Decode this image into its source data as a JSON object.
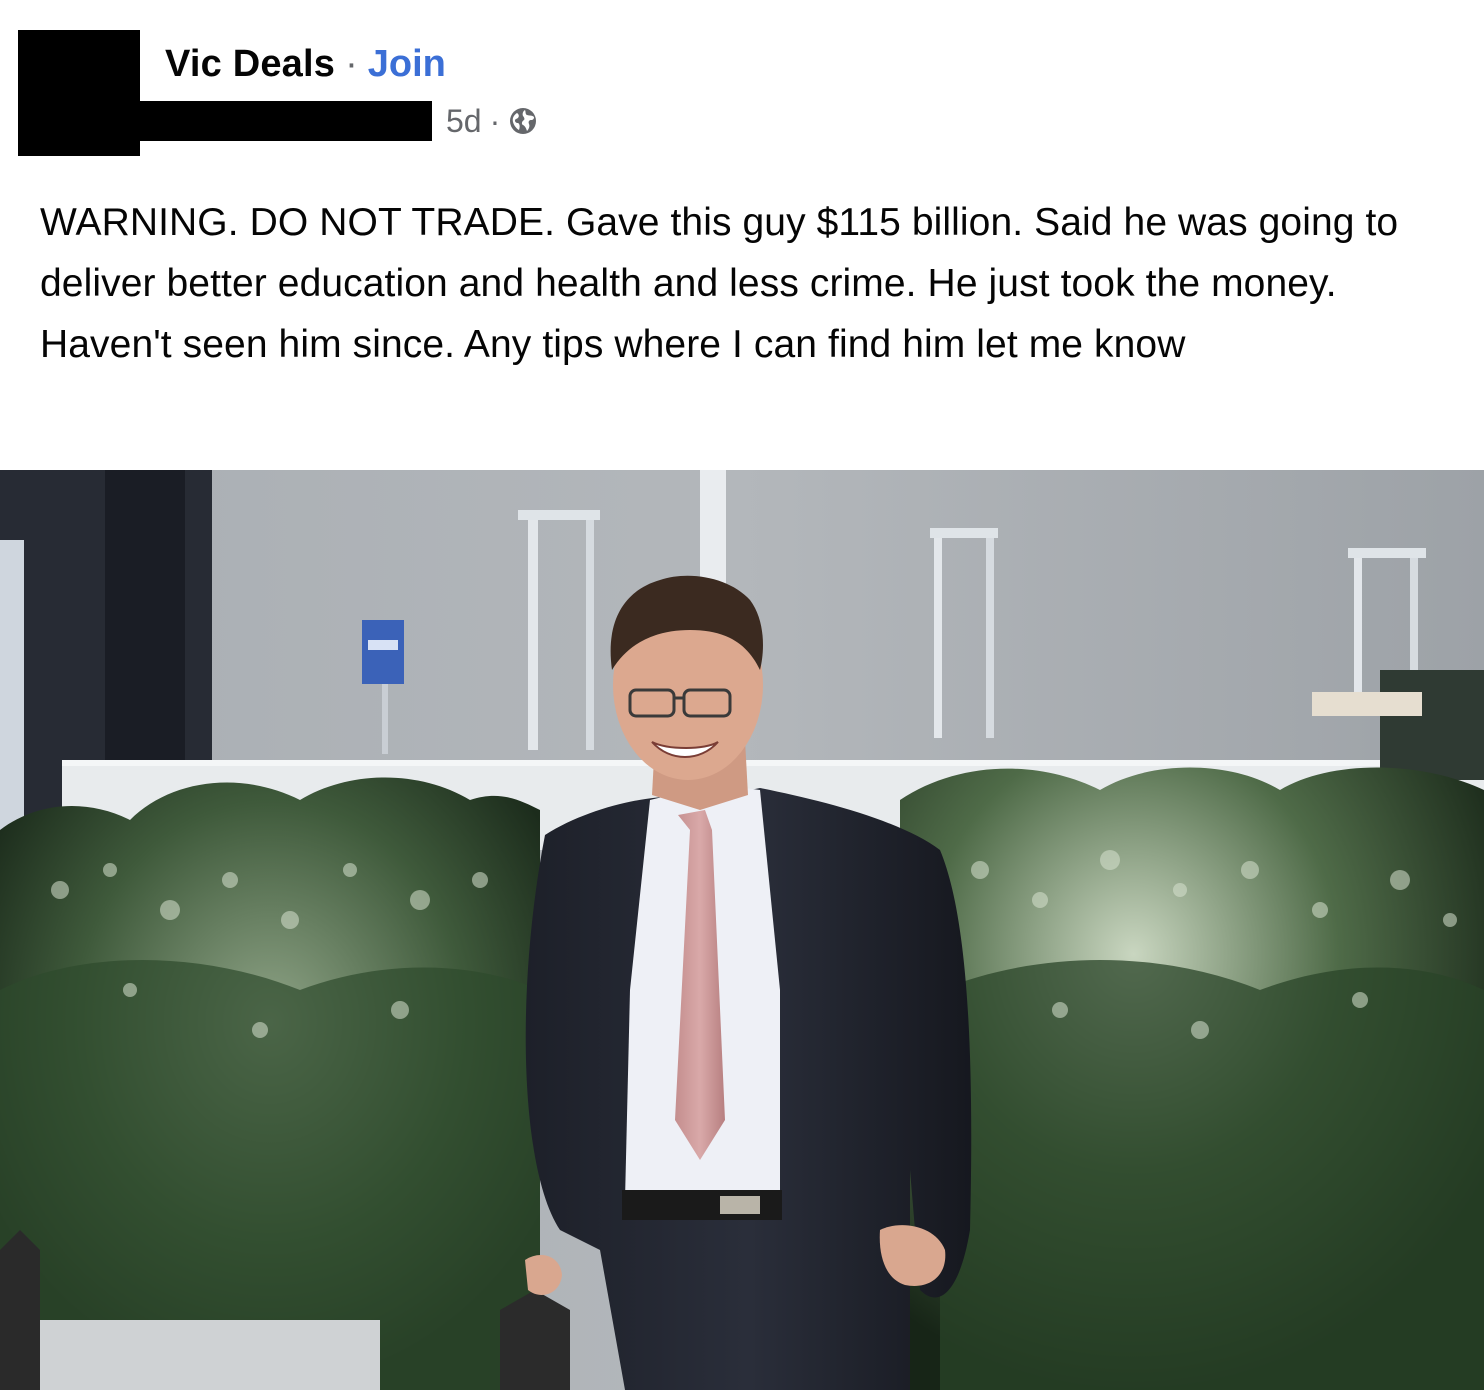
{
  "post": {
    "group_name": "Vic Deals",
    "separator": "·",
    "join_label": "Join",
    "timestamp": "5d",
    "meta_separator": "·",
    "privacy_icon": "globe-icon",
    "body": "WARNING. DO NOT TRADE. Gave this guy $115 billion. Said he was going to deliver better education and health and less crime. He just took the money. Haven't seen him since. Any tips where I can find him let me know",
    "redacted": [
      "avatar",
      "author-name"
    ]
  },
  "colors": {
    "link": "#3b6fd6",
    "secondary_text": "#65676b",
    "primary_text": "#050505",
    "redaction": "#000000"
  }
}
